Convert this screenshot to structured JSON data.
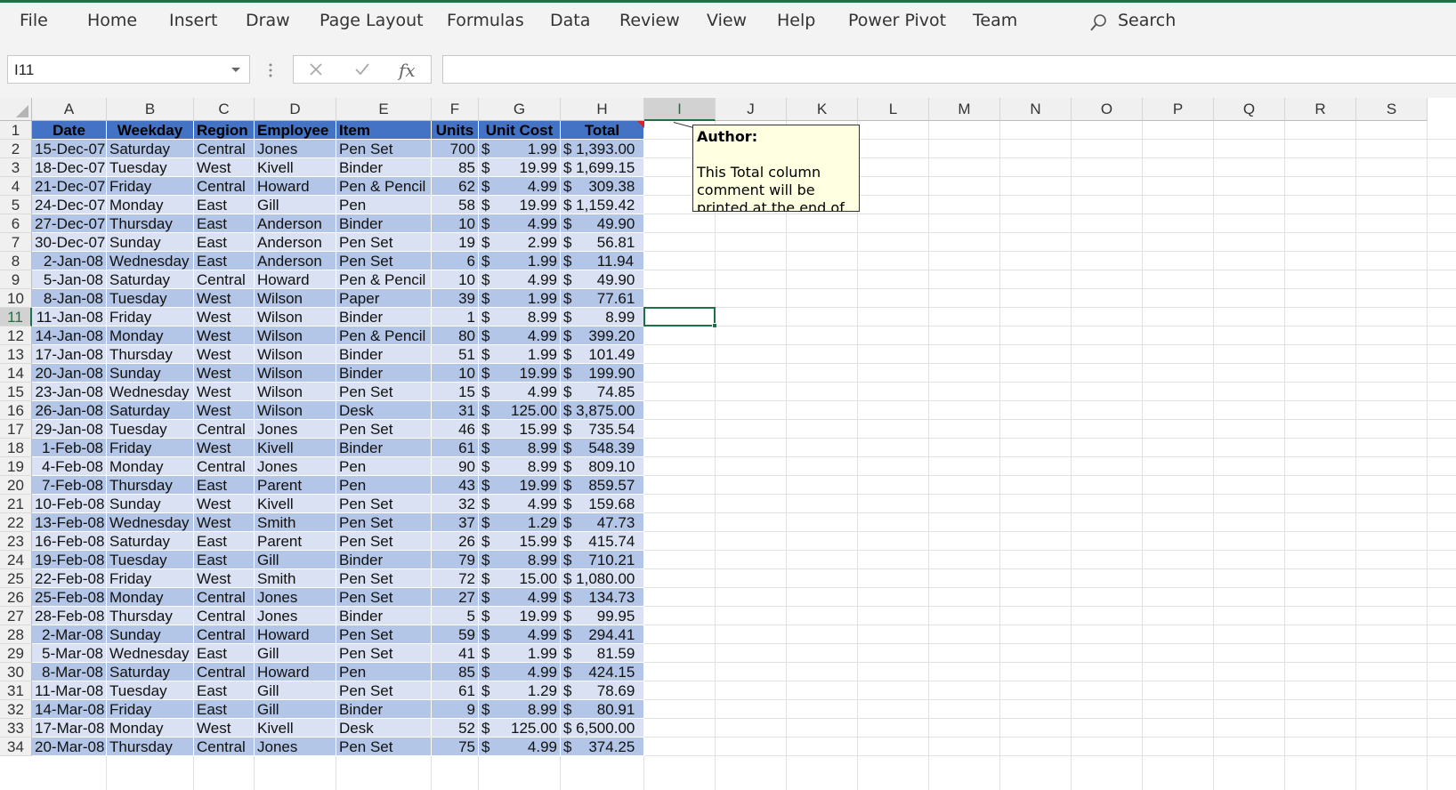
{
  "ribbon": {
    "tabs": [
      "File",
      "Home",
      "Insert",
      "Draw",
      "Page Layout",
      "Formulas",
      "Data",
      "Review",
      "View",
      "Help",
      "Power Pivot",
      "Team"
    ],
    "search_label": "Search"
  },
  "formula_bar": {
    "name_box": "I11",
    "cancel_icon": "x-icon",
    "enter_icon": "check-icon",
    "fx_label": "fx",
    "formula": ""
  },
  "grid": {
    "selected_cell": "I11",
    "columns": [
      "A",
      "B",
      "C",
      "D",
      "E",
      "F",
      "G",
      "H",
      "I",
      "J",
      "K",
      "L",
      "M",
      "N",
      "O",
      "P",
      "Q",
      "R",
      "S"
    ],
    "rows": [
      "1",
      "2",
      "3",
      "4",
      "5",
      "6",
      "7",
      "8",
      "9",
      "10",
      "11",
      "12",
      "13",
      "14",
      "15",
      "16",
      "17",
      "18",
      "19",
      "20",
      "21",
      "22",
      "23",
      "24",
      "25",
      "26",
      "27",
      "28",
      "29",
      "30",
      "31",
      "32",
      "33",
      "34"
    ],
    "table_headers": [
      "Date",
      "Weekday",
      "Region",
      "Employee",
      "Item",
      "Units",
      "Unit Cost",
      "Total"
    ],
    "table_rows": [
      [
        "15-Dec-07",
        "Saturday",
        "Central",
        "Jones",
        "Pen Set",
        "700",
        "$",
        "1.99",
        "$ 1,393.00"
      ],
      [
        "18-Dec-07",
        "Tuesday",
        "West",
        "Kivell",
        "Binder",
        "85",
        "$",
        "19.99",
        "$ 1,699.15"
      ],
      [
        "21-Dec-07",
        "Friday",
        "Central",
        "Howard",
        "Pen & Pencil",
        "62",
        "$",
        "4.99",
        "$    309.38"
      ],
      [
        "24-Dec-07",
        "Monday",
        "East",
        "Gill",
        "Pen",
        "58",
        "$",
        "19.99",
        "$ 1,159.42"
      ],
      [
        "27-Dec-07",
        "Thursday",
        "East",
        "Anderson",
        "Binder",
        "10",
        "$",
        "4.99",
        "$      49.90"
      ],
      [
        "30-Dec-07",
        "Sunday",
        "East",
        "Anderson",
        "Pen Set",
        "19",
        "$",
        "2.99",
        "$      56.81"
      ],
      [
        "2-Jan-08",
        "Wednesday",
        "East",
        "Anderson",
        "Pen Set",
        "6",
        "$",
        "1.99",
        "$      11.94"
      ],
      [
        "5-Jan-08",
        "Saturday",
        "Central",
        "Howard",
        "Pen & Pencil",
        "10",
        "$",
        "4.99",
        "$      49.90"
      ],
      [
        "8-Jan-08",
        "Tuesday",
        "West",
        "Wilson",
        "Paper",
        "39",
        "$",
        "1.99",
        "$      77.61"
      ],
      [
        "11-Jan-08",
        "Friday",
        "West",
        "Wilson",
        "Binder",
        "1",
        "$",
        "8.99",
        "$        8.99"
      ],
      [
        "14-Jan-08",
        "Monday",
        "West",
        "Wilson",
        "Pen & Pencil",
        "80",
        "$",
        "4.99",
        "$    399.20"
      ],
      [
        "17-Jan-08",
        "Thursday",
        "West",
        "Wilson",
        "Binder",
        "51",
        "$",
        "1.99",
        "$    101.49"
      ],
      [
        "20-Jan-08",
        "Sunday",
        "West",
        "Wilson",
        "Binder",
        "10",
        "$",
        "19.99",
        "$    199.90"
      ],
      [
        "23-Jan-08",
        "Wednesday",
        "West",
        "Wilson",
        "Pen Set",
        "15",
        "$",
        "4.99",
        "$      74.85"
      ],
      [
        "26-Jan-08",
        "Saturday",
        "West",
        "Wilson",
        "Desk",
        "31",
        "$",
        "125.00",
        "$ 3,875.00"
      ],
      [
        "29-Jan-08",
        "Tuesday",
        "Central",
        "Jones",
        "Pen Set",
        "46",
        "$",
        "15.99",
        "$    735.54"
      ],
      [
        "1-Feb-08",
        "Friday",
        "West",
        "Kivell",
        "Binder",
        "61",
        "$",
        "8.99",
        "$    548.39"
      ],
      [
        "4-Feb-08",
        "Monday",
        "Central",
        "Jones",
        "Pen",
        "90",
        "$",
        "8.99",
        "$    809.10"
      ],
      [
        "7-Feb-08",
        "Thursday",
        "East",
        "Parent",
        "Pen",
        "43",
        "$",
        "19.99",
        "$    859.57"
      ],
      [
        "10-Feb-08",
        "Sunday",
        "West",
        "Kivell",
        "Pen Set",
        "32",
        "$",
        "4.99",
        "$    159.68"
      ],
      [
        "13-Feb-08",
        "Wednesday",
        "West",
        "Smith",
        "Pen Set",
        "37",
        "$",
        "1.29",
        "$      47.73"
      ],
      [
        "16-Feb-08",
        "Saturday",
        "East",
        "Parent",
        "Pen Set",
        "26",
        "$",
        "15.99",
        "$    415.74"
      ],
      [
        "19-Feb-08",
        "Tuesday",
        "East",
        "Gill",
        "Binder",
        "79",
        "$",
        "8.99",
        "$    710.21"
      ],
      [
        "22-Feb-08",
        "Friday",
        "West",
        "Smith",
        "Pen Set",
        "72",
        "$",
        "15.00",
        "$ 1,080.00"
      ],
      [
        "25-Feb-08",
        "Monday",
        "Central",
        "Jones",
        "Pen Set",
        "27",
        "$",
        "4.99",
        "$    134.73"
      ],
      [
        "28-Feb-08",
        "Thursday",
        "Central",
        "Jones",
        "Binder",
        "5",
        "$",
        "19.99",
        "$      99.95"
      ],
      [
        "2-Mar-08",
        "Sunday",
        "Central",
        "Howard",
        "Pen Set",
        "59",
        "$",
        "4.99",
        "$    294.41"
      ],
      [
        "5-Mar-08",
        "Wednesday",
        "East",
        "Gill",
        "Pen Set",
        "41",
        "$",
        "1.99",
        "$      81.59"
      ],
      [
        "8-Mar-08",
        "Saturday",
        "Central",
        "Howard",
        "Pen",
        "85",
        "$",
        "4.99",
        "$    424.15"
      ],
      [
        "11-Mar-08",
        "Tuesday",
        "East",
        "Gill",
        "Pen Set",
        "61",
        "$",
        "1.29",
        "$      78.69"
      ],
      [
        "14-Mar-08",
        "Friday",
        "East",
        "Gill",
        "Binder",
        "9",
        "$",
        "8.99",
        "$      80.91"
      ],
      [
        "17-Mar-08",
        "Monday",
        "West",
        "Kivell",
        "Desk",
        "52",
        "$",
        "125.00",
        "$ 6,500.00"
      ],
      [
        "20-Mar-08",
        "Thursday",
        "Central",
        "Jones",
        "Pen Set",
        "75",
        "$",
        "4.99",
        "$    374.25"
      ]
    ]
  },
  "comment": {
    "author": "Author:",
    "text": "This Total column comment will be printed at the end of sheet."
  },
  "colors": {
    "accent": "#1e7145",
    "header_fill": "#4472c4",
    "band_dark": "#b4c6e7",
    "band_light": "#d9e1f2",
    "comment_fill": "#ffffe1"
  }
}
